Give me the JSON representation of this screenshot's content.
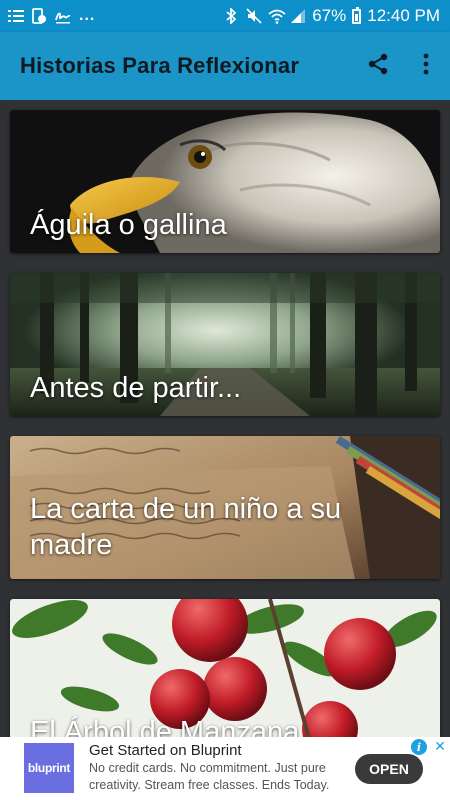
{
  "status_bar": {
    "battery": "67%",
    "time": "12:40 PM",
    "overflow": "..."
  },
  "app_bar": {
    "title": "Historias Para Reflexionar",
    "icons": [
      "share-icon",
      "more-vert-icon"
    ]
  },
  "stories": [
    {
      "title": "Águila o gallina",
      "image": "eagle-head"
    },
    {
      "title": "Antes de partir...",
      "image": "misty-forest-path"
    },
    {
      "title": "La carta de un niño a su madre",
      "image": "old-handwritten-letter"
    },
    {
      "title": "El Árbol de Manzana.",
      "image": "red-apples-on-branch"
    }
  ],
  "ad": {
    "logo_text": "bluprint",
    "headline": "Get Started on Bluprint",
    "body": "No credit cards. No commitment. Just pure creativity. Stream free classes. Ends Today.",
    "cta": "OPEN",
    "brand_color": "#6a6ee0"
  },
  "colors": {
    "status_bar": "#0d8fc9",
    "app_bar": "#1b94c8",
    "background": "#2f3134"
  }
}
